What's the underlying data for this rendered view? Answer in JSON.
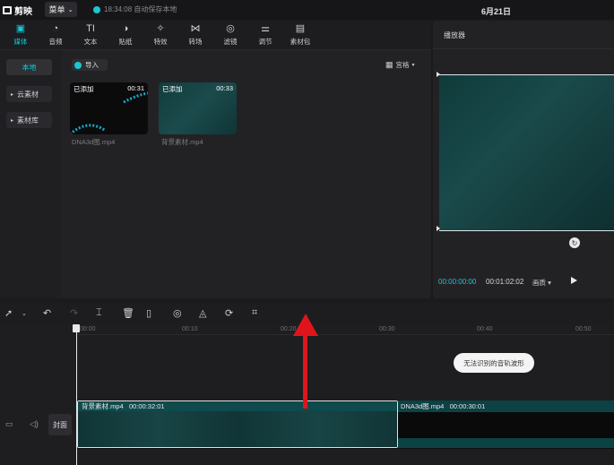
{
  "app": {
    "name": "剪映",
    "menu_label": "菜单",
    "save_status": "18:34:08 自动保存本地",
    "date": "6月21日"
  },
  "tabs": [
    {
      "label": "媒体",
      "icon": "media-icon",
      "glyph": "▣",
      "active": true
    },
    {
      "label": "音频",
      "icon": "audio-icon",
      "glyph": "◔"
    },
    {
      "label": "文本",
      "icon": "text-icon",
      "glyph": "TI"
    },
    {
      "label": "贴纸",
      "icon": "sticker-icon",
      "glyph": "◑"
    },
    {
      "label": "特效",
      "icon": "effects-icon",
      "glyph": "✧"
    },
    {
      "label": "转场",
      "icon": "transition-icon",
      "glyph": "⋈"
    },
    {
      "label": "滤镜",
      "icon": "filter-icon",
      "glyph": "◎"
    },
    {
      "label": "调节",
      "icon": "adjust-icon",
      "glyph": "⚌"
    },
    {
      "label": "素材包",
      "icon": "package-icon",
      "glyph": "▤"
    }
  ],
  "sidebar": {
    "items": [
      {
        "label": "本地",
        "active": true
      },
      {
        "label": "云素材"
      },
      {
        "label": "素材库"
      }
    ]
  },
  "media": {
    "import_label": "导入",
    "sort_label": "宫格",
    "clips": [
      {
        "tag": "已添加",
        "duration": "00:31",
        "name": "DNA3d图.mp4"
      },
      {
        "tag": "已添加",
        "duration": "00:33",
        "name": "背景素材.mp4"
      }
    ]
  },
  "player": {
    "title": "播放器",
    "current_time": "00:00:00:00",
    "total_time": "00:01:02:02",
    "ratio_label": "画质"
  },
  "timeline": {
    "ruler": [
      "00:00",
      "00:10",
      "00:20",
      "00:30",
      "00:40",
      "00:50"
    ],
    "toast": "无法识别的音轨波形",
    "cover_label": "封面",
    "clips": [
      {
        "name": "背景素材.mp4",
        "duration": "00:00:32:01"
      },
      {
        "name": "DNA3d图.mp4",
        "duration": "00:00:30:01"
      }
    ]
  },
  "colors": {
    "accent": "#19c7d1",
    "arrow": "#e0151b"
  }
}
